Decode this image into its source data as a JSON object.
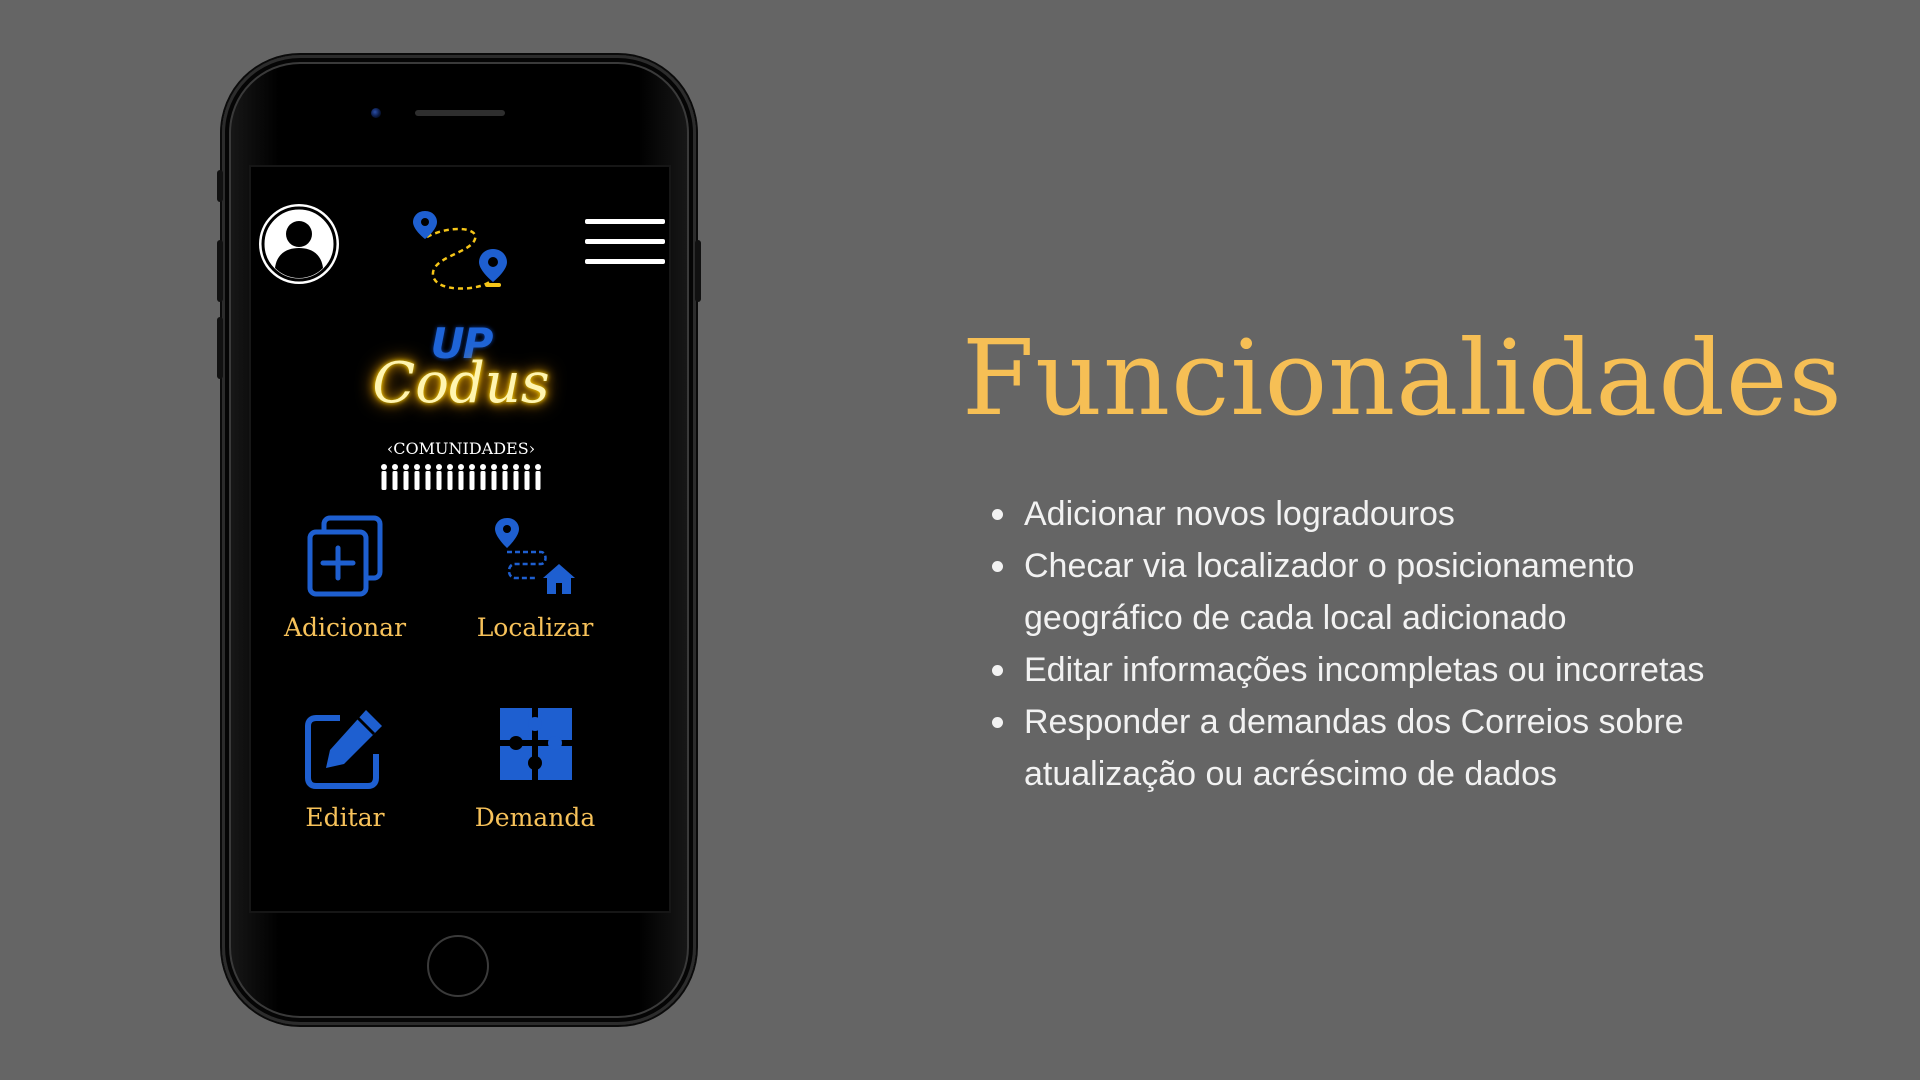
{
  "app": {
    "brand_up": "UP",
    "brand_codus": "Codus",
    "subtitle": "‹COMUNIDADES›",
    "tiles": [
      {
        "label": "Adicionar",
        "icon": "add-copy-icon"
      },
      {
        "label": "Localizar",
        "icon": "route-home-icon"
      },
      {
        "label": "Editar",
        "icon": "edit-icon"
      },
      {
        "label": "Demanda",
        "icon": "puzzle-icon"
      }
    ],
    "icons": {
      "avatar": "user-avatar-icon",
      "menu": "hamburger-menu-icon",
      "logo": "route-pins-icon"
    }
  },
  "slide": {
    "title": "Funcionalidades",
    "bullets": [
      "Adicionar novos logradouros",
      "Checar via localizador o posicionamento geográfico de cada local adicionado",
      "Editar informações incompletas ou incorretas",
      "Responder a demandas dos Correios sobre atualização ou acréscimo de dados"
    ]
  },
  "colors": {
    "background": "#656565",
    "title": "#f6bf55",
    "tile_label": "#f7c25a",
    "icon_blue": "#1e5fd0",
    "neon_yellow": "#ffd400"
  }
}
